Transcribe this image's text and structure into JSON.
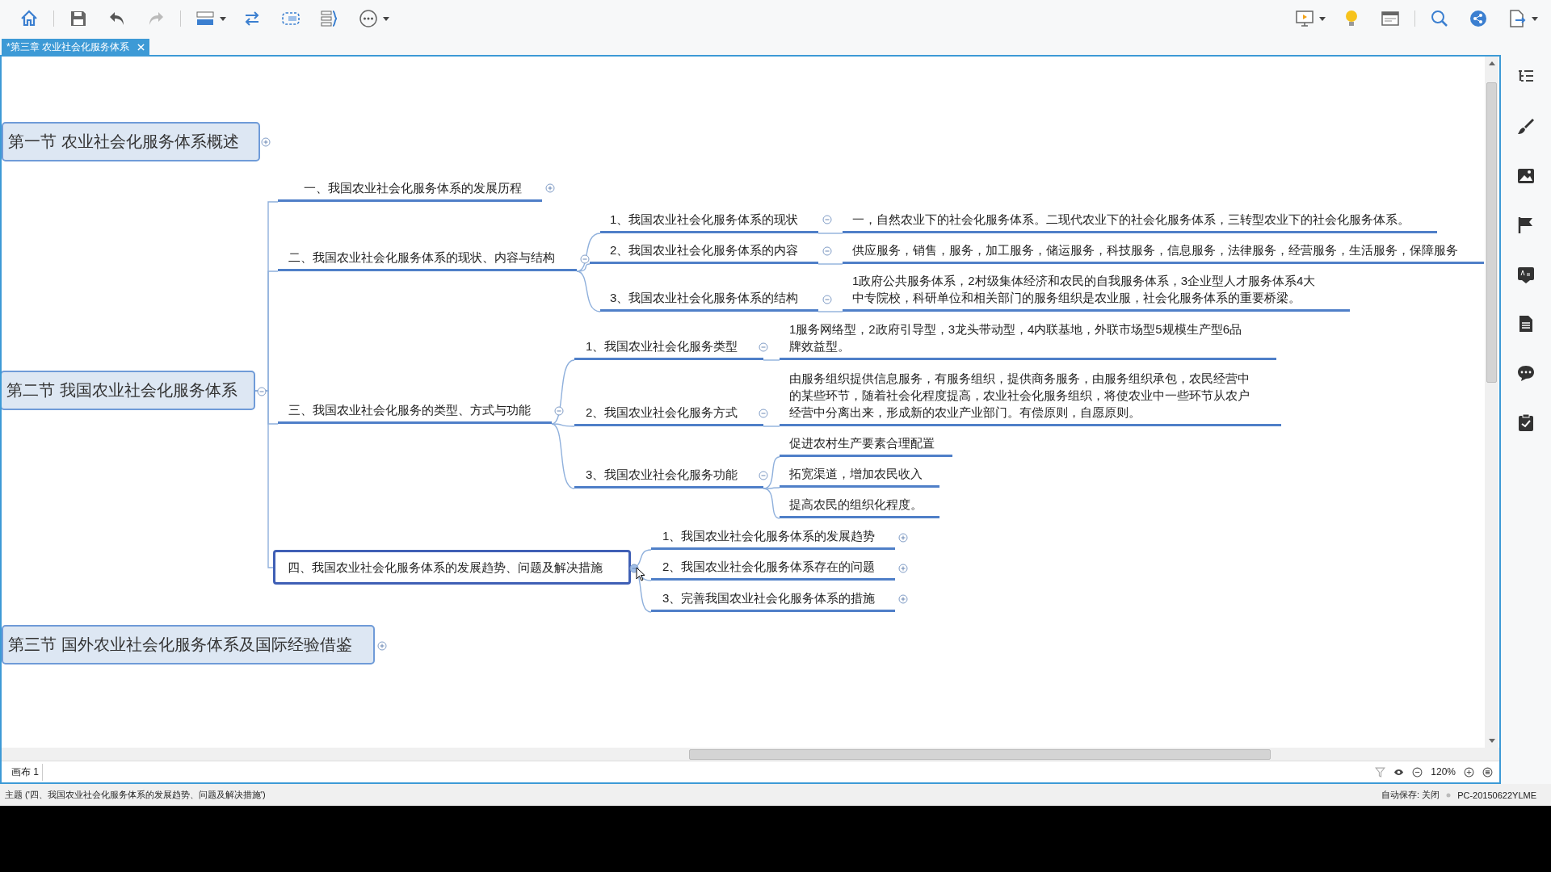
{
  "tab": {
    "label": "*第三章  农业社会化服务体系"
  },
  "map": {
    "topics": [
      {
        "label": "第一节  农业社会化服务体系概述",
        "expanded": false
      },
      {
        "label": "第二节  我国农业社会化服务体系",
        "expanded": true,
        "children": [
          {
            "label": "一、我国农业社会化服务体系的发展历程",
            "expanded": false,
            "selected": false
          },
          {
            "label": "二、我国农业社会化服务体系的现状、内容与结构",
            "expanded": true,
            "selected": false,
            "children": [
              {
                "label": "1、我国农业社会化服务体系的现状",
                "expanded": true,
                "children": [
                  {
                    "label": "一，自然农业下的社会化服务体系。二现代农业下的社会化服务体系，三转型农业下的社会化服务体系。"
                  }
                ]
              },
              {
                "label": "2、我国农业社会化服务体系的内容",
                "expanded": true,
                "children": [
                  {
                    "label": "供应服务，销售，服务，加工服务，储运服务，科技服务，信息服务，法律服务，经营服务，生活服务，保障服务"
                  }
                ]
              },
              {
                "label": "3、我国农业社会化服务体系的结构",
                "expanded": true,
                "children": [
                  {
                    "label": "1政府公共服务体系，2村级集体经济和农民的自我服务体系，3企业型人才服务体系4大中专院校，科研单位和相关部门的服务组织是农业服，社会化服务体系的重要桥梁。"
                  }
                ]
              }
            ]
          },
          {
            "label": "三、我国农业社会化服务的类型、方式与功能",
            "expanded": true,
            "selected": false,
            "children": [
              {
                "label": "1、我国农业社会化服务类型",
                "expanded": true,
                "children": [
                  {
                    "label": "1服务网络型，2政府引导型，3龙头带动型，4内联基地，外联市场型5规模生产型6品牌效益型。"
                  }
                ]
              },
              {
                "label": "2、我国农业社会化服务方式",
                "expanded": true,
                "children": [
                  {
                    "label": "由服务组织提供信息服务，有服务组织，提供商务服务，由服务组织承包，农民经营中的某些环节，随着社会化程度提高，农业社会化服务组织，将使农业中一些环节从农户经营中分离出来，形成新的农业产业部门。有偿原则，自愿原则。"
                  }
                ]
              },
              {
                "label": "3、我国农业社会化服务功能",
                "expanded": true,
                "children": [
                  {
                    "label": "促进农村生产要素合理配置"
                  },
                  {
                    "label": "拓宽渠道，增加农民收入"
                  },
                  {
                    "label": "提高农民的组织化程度。"
                  }
                ]
              }
            ]
          },
          {
            "label": "四、我国农业社会化服务体系的发展趋势、问题及解决措施",
            "expanded": true,
            "selected": true,
            "children": [
              {
                "label": "1、我国农业社会化服务体系的发展趋势",
                "expanded": false
              },
              {
                "label": "2、我国农业社会化服务体系存在的问题",
                "expanded": false
              },
              {
                "label": "3、完善我国农业社会化服务体系的措施",
                "expanded": false
              }
            ]
          }
        ]
      },
      {
        "label": "第三节  国外农业社会化服务体系及国际经验借鉴",
        "expanded": false
      }
    ]
  },
  "sheet_tab": {
    "label": "画布 1"
  },
  "zoom": {
    "value": "120%"
  },
  "status_bar": {
    "topic": "主题 ('四、我国农业社会化服务体系的发展趋势、问题及解决措施')",
    "autosave": "自动保存: 关闭",
    "computer": "PC-20150622YLME"
  }
}
